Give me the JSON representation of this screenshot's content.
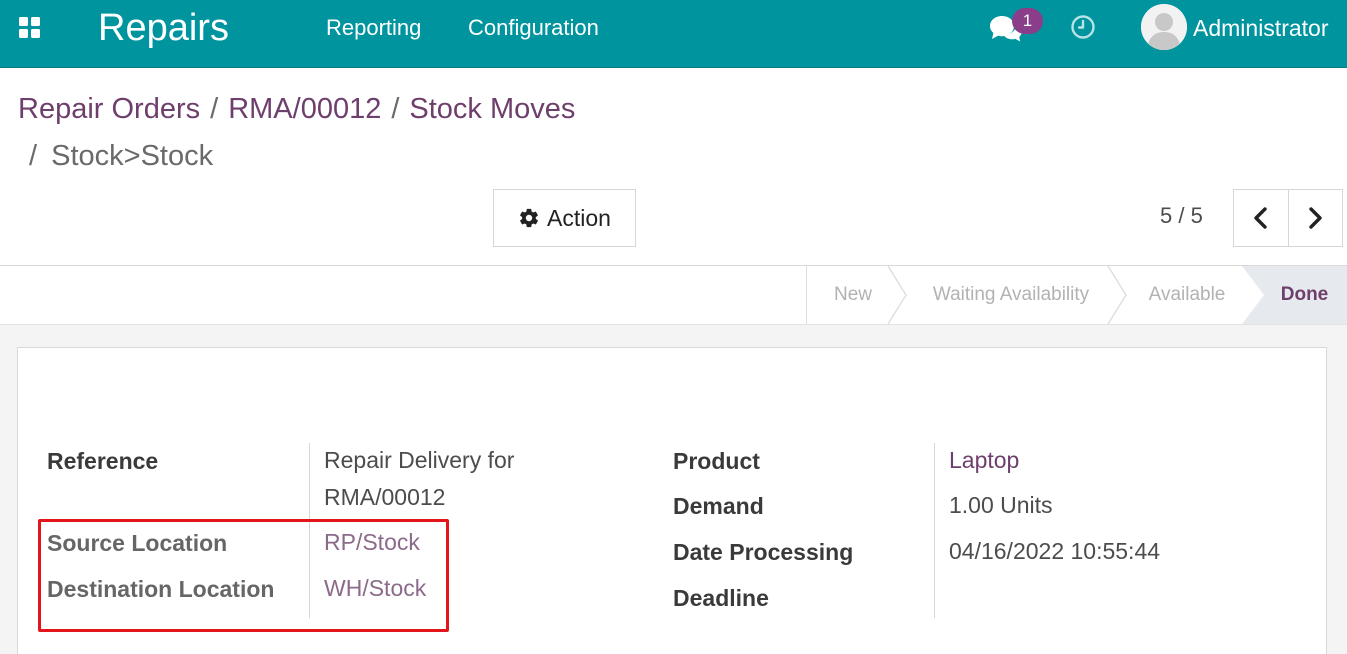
{
  "navbar": {
    "app_name": "Repairs",
    "menu": [
      "Reporting",
      "Configuration"
    ],
    "chat_badge_count": "1",
    "user_name": "Administrator",
    "icons": [
      "apps-grid-icon",
      "chat-icon",
      "clock-icon",
      "user-avatar"
    ]
  },
  "breadcrumb": {
    "items": [
      "Repair Orders",
      "RMA/00012",
      "Stock Moves"
    ],
    "separator": "/",
    "current": "Stock>Stock"
  },
  "controls": {
    "action_label": "Action",
    "pager": "5 / 5"
  },
  "status_stages": [
    "New",
    "Waiting Availability",
    "Available",
    "Done"
  ],
  "current_stage": "Done",
  "form": {
    "left": {
      "reference_label": "Reference",
      "reference_value_line1": "Repair Delivery for",
      "reference_value_line2": "RMA/00012",
      "source_label": "Source Location",
      "source_value": "RP/Stock",
      "destination_label": "Destination Location",
      "destination_value": "WH/Stock"
    },
    "right": {
      "product_label": "Product",
      "product_value": "Laptop",
      "demand_label": "Demand",
      "demand_value": "1.00 Units",
      "date_label": "Date Processing",
      "date_value": "04/16/2022 10:55:44",
      "deadline_label": "Deadline",
      "deadline_value": ""
    }
  },
  "colors": {
    "navbar": "#00959e",
    "link": "#6e3f6c",
    "highlight_box": "#e3141a",
    "badge": "#8a3e8a"
  }
}
